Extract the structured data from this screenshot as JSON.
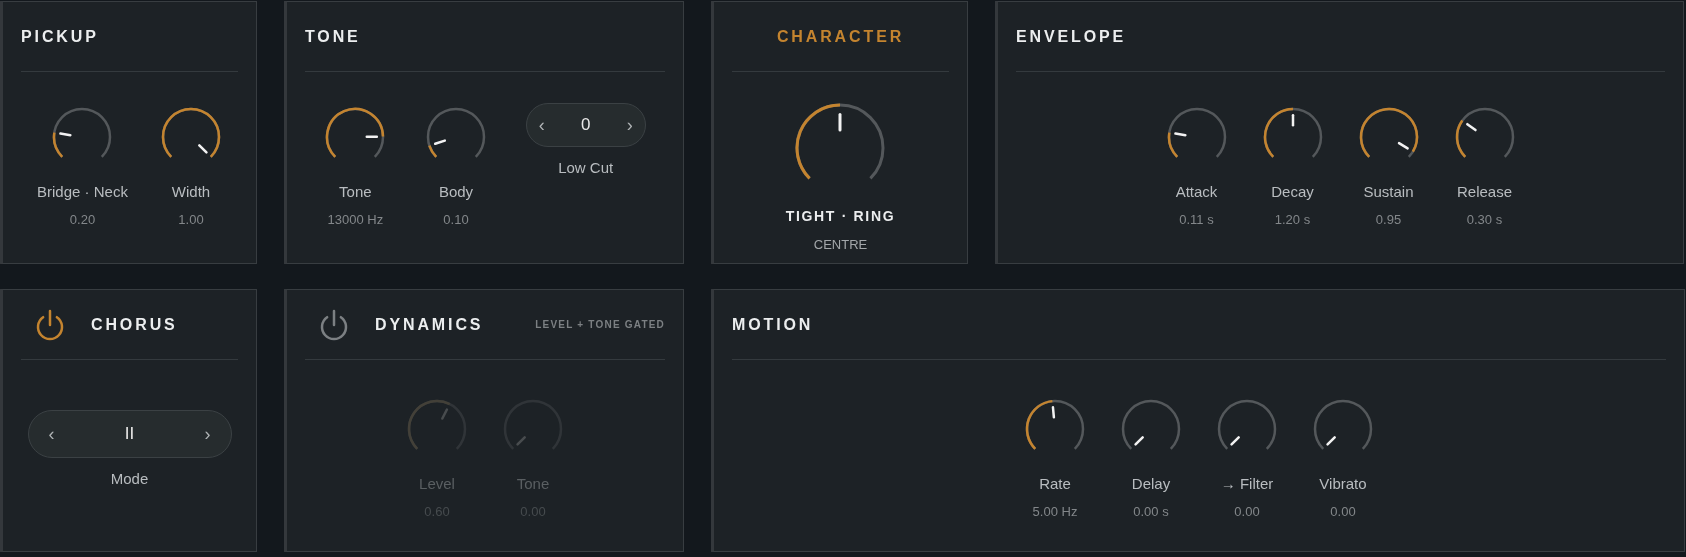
{
  "rows": [
    {
      "panels": [
        {
          "title": "PICKUP",
          "accent": false,
          "enabled": true,
          "controls": [
            {
              "kind": "knob",
              "label": "Bridge · Neck",
              "value": "0.20"
            },
            {
              "kind": "knob",
              "label": "Width",
              "value": "1.00"
            }
          ]
        },
        {
          "title": "TONE",
          "accent": false,
          "enabled": true,
          "controls": [
            {
              "kind": "knob",
              "label": "Tone",
              "value": "13000 Hz"
            },
            {
              "kind": "knob",
              "label": "Body",
              "value": "0.10"
            },
            {
              "kind": "stepper",
              "prev": "‹",
              "value": "0",
              "next": "›",
              "label": "Low Cut"
            }
          ]
        },
        {
          "title": "CHARACTER",
          "accent": true,
          "enabled": true,
          "controls": [
            {
              "kind": "bigknob",
              "label": "TIGHT · RING",
              "value": "CENTRE"
            }
          ]
        },
        {
          "title": "ENVELOPE",
          "accent": false,
          "enabled": true,
          "controls": [
            {
              "kind": "knob",
              "label": "Attack",
              "value": "0.11 s"
            },
            {
              "kind": "knob",
              "label": "Decay",
              "value": "1.20 s"
            },
            {
              "kind": "knob",
              "label": "Sustain",
              "value": "0.95"
            },
            {
              "kind": "knob",
              "label": "Release",
              "value": "0.30 s"
            }
          ]
        }
      ]
    },
    {
      "panels": [
        {
          "title": "CHORUS",
          "power": {
            "on": true
          },
          "accent": false,
          "enabled": true,
          "controls": [
            {
              "kind": "widestepper",
              "prev": "‹",
              "value": "II",
              "next": "›",
              "label": "Mode"
            }
          ]
        },
        {
          "title": "DYNAMICS",
          "power": {
            "on": false
          },
          "subtitle": "LEVEL + TONE GATED",
          "accent": false,
          "enabled": false,
          "controls": [
            {
              "kind": "knob",
              "label": "Level",
              "value": "0.60"
            },
            {
              "kind": "knob",
              "label": "Tone",
              "value": "0.00"
            }
          ]
        },
        {
          "title": "MOTION",
          "accent": false,
          "enabled": true,
          "controls": [
            {
              "kind": "knob",
              "label": "Rate",
              "value": "5.00 Hz"
            },
            {
              "kind": "knob",
              "label": "Delay",
              "value": "0.00 s"
            },
            {
              "kind": "knob",
              "label": "→ Filter",
              "value": "0.00"
            },
            {
              "kind": "knob",
              "label": "Vibrato",
              "value": "0.00"
            }
          ]
        }
      ]
    }
  ]
}
